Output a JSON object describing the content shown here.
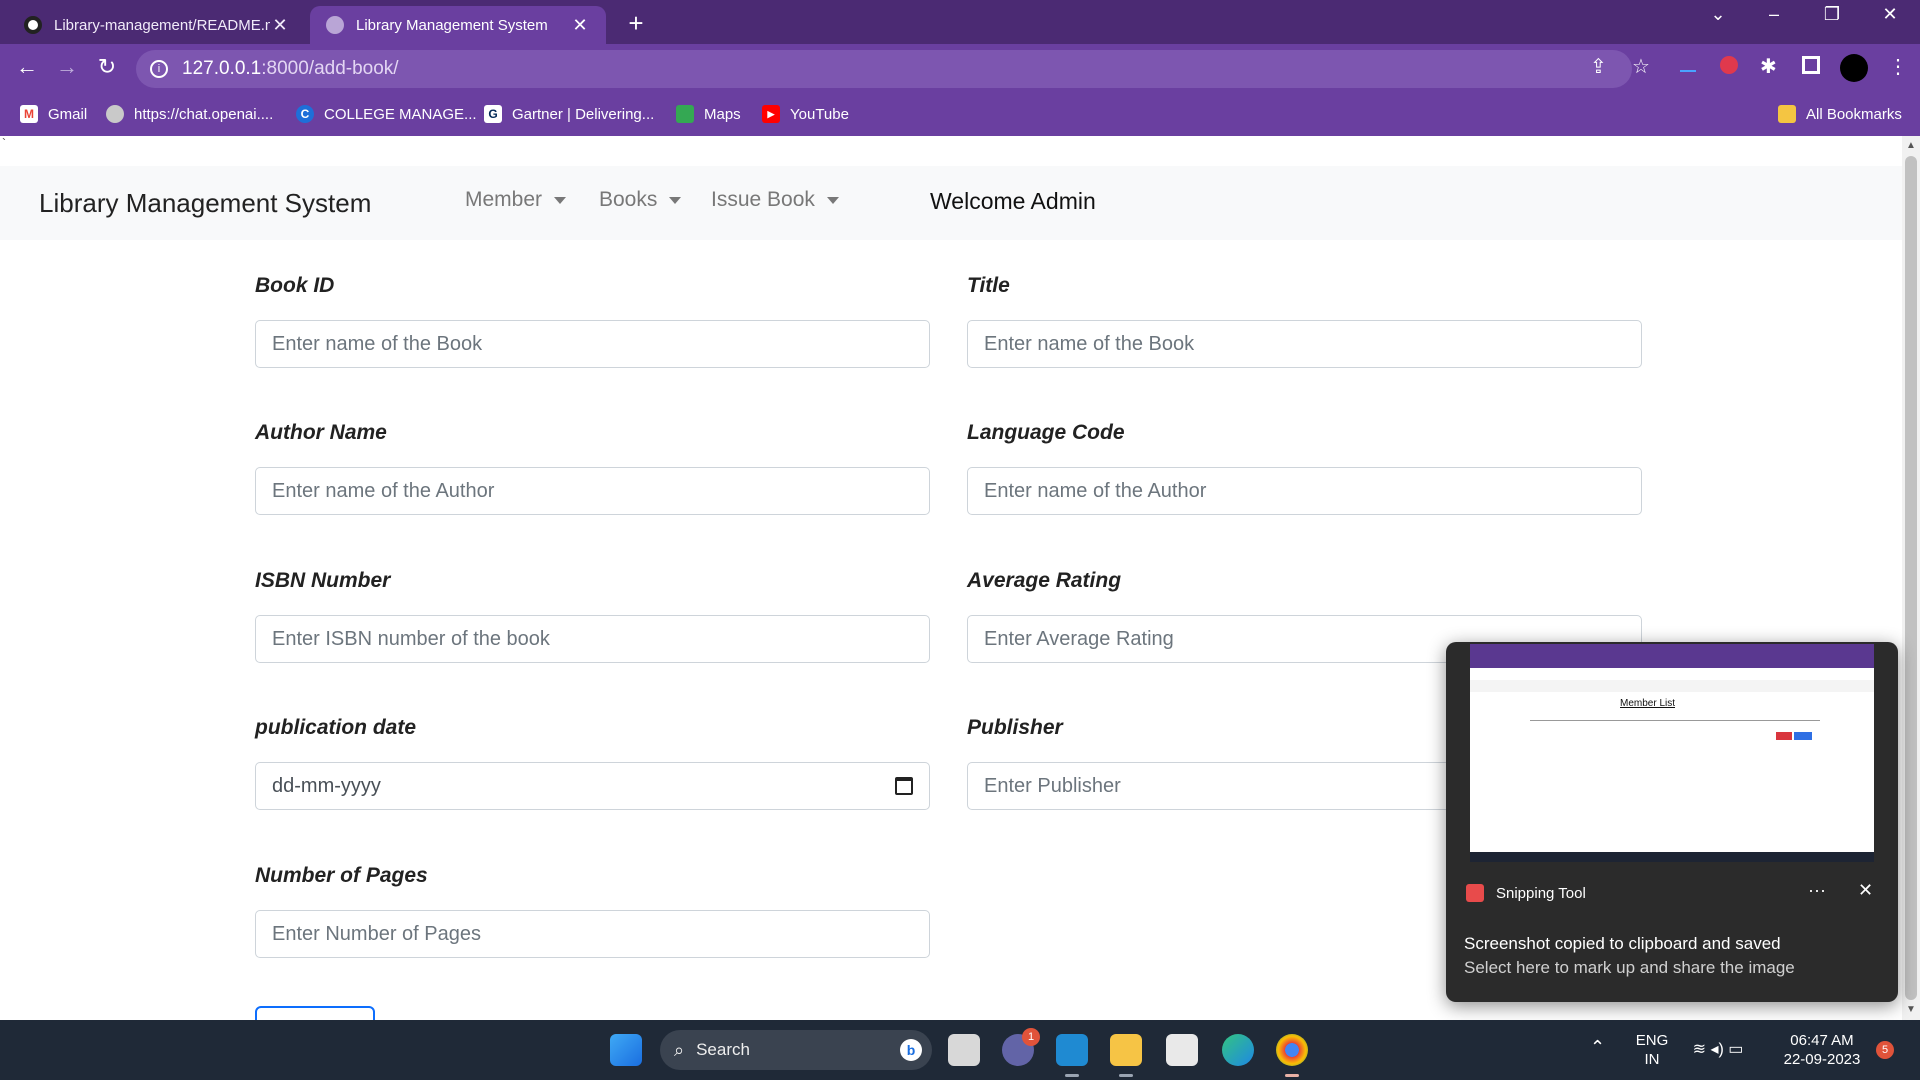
{
  "browser": {
    "tabs": [
      {
        "title": "Library-management/README.md",
        "active": false
      },
      {
        "title": "Library Management System",
        "active": true
      }
    ],
    "url_host": "127.0.0.1",
    "url_path": ":8000/add-book/",
    "bookmarks": [
      {
        "label": "Gmail",
        "icon": "gmail-icon"
      },
      {
        "label": "https://chat.openai....",
        "icon": "openai-icon"
      },
      {
        "label": "COLLEGE MANAGE...",
        "icon": "college-icon"
      },
      {
        "label": "Gartner | Delivering...",
        "icon": "gartner-icon"
      },
      {
        "label": "Maps",
        "icon": "maps-icon"
      },
      {
        "label": "YouTube",
        "icon": "youtube-icon"
      }
    ],
    "all_bookmarks": "All Bookmarks",
    "tick_mark": "`"
  },
  "page": {
    "brand": "Library Management System",
    "nav": {
      "member": "Member",
      "books": "Books",
      "issue_book": "Issue Book"
    },
    "welcome": "Welcome Admin",
    "form": {
      "book_id": {
        "label": "Book ID",
        "placeholder": "Enter name of the Book"
      },
      "title": {
        "label": "Title",
        "placeholder": "Enter name of the Book"
      },
      "author_name": {
        "label": "Author Name",
        "placeholder": "Enter name of the Author"
      },
      "language_code": {
        "label": "Language Code",
        "placeholder": "Enter name of the Author"
      },
      "isbn": {
        "label": "ISBN Number",
        "placeholder": "Enter ISBN number of the book"
      },
      "avg_rating": {
        "label": "Average Rating",
        "placeholder": "Enter Average Rating"
      },
      "pub_date": {
        "label": "publication date",
        "value": "dd-mm-yyyy"
      },
      "publisher": {
        "label": "Publisher",
        "placeholder": "Enter Publisher"
      },
      "pages": {
        "label": "Number of Pages",
        "placeholder": "Enter Number of Pages"
      }
    }
  },
  "toast": {
    "app_name": "Snipping Tool",
    "thumbnail_title": "Member List",
    "message": "Screenshot copied to clipboard and saved",
    "sub_message": "Select here to mark up and share the image",
    "more": "···",
    "close": "✕"
  },
  "taskbar": {
    "search_label": "Search",
    "teams_badge": "1",
    "lang_top": "ENG",
    "lang_bottom": "IN",
    "time": "06:47 AM",
    "date": "22-09-2023",
    "notif_count": "5"
  },
  "colors": {
    "tabstrip": "#4b2a73",
    "toolbar": "#6a3fa0",
    "taskbar": "#1f2937",
    "submit_border": "#0d6efd"
  }
}
